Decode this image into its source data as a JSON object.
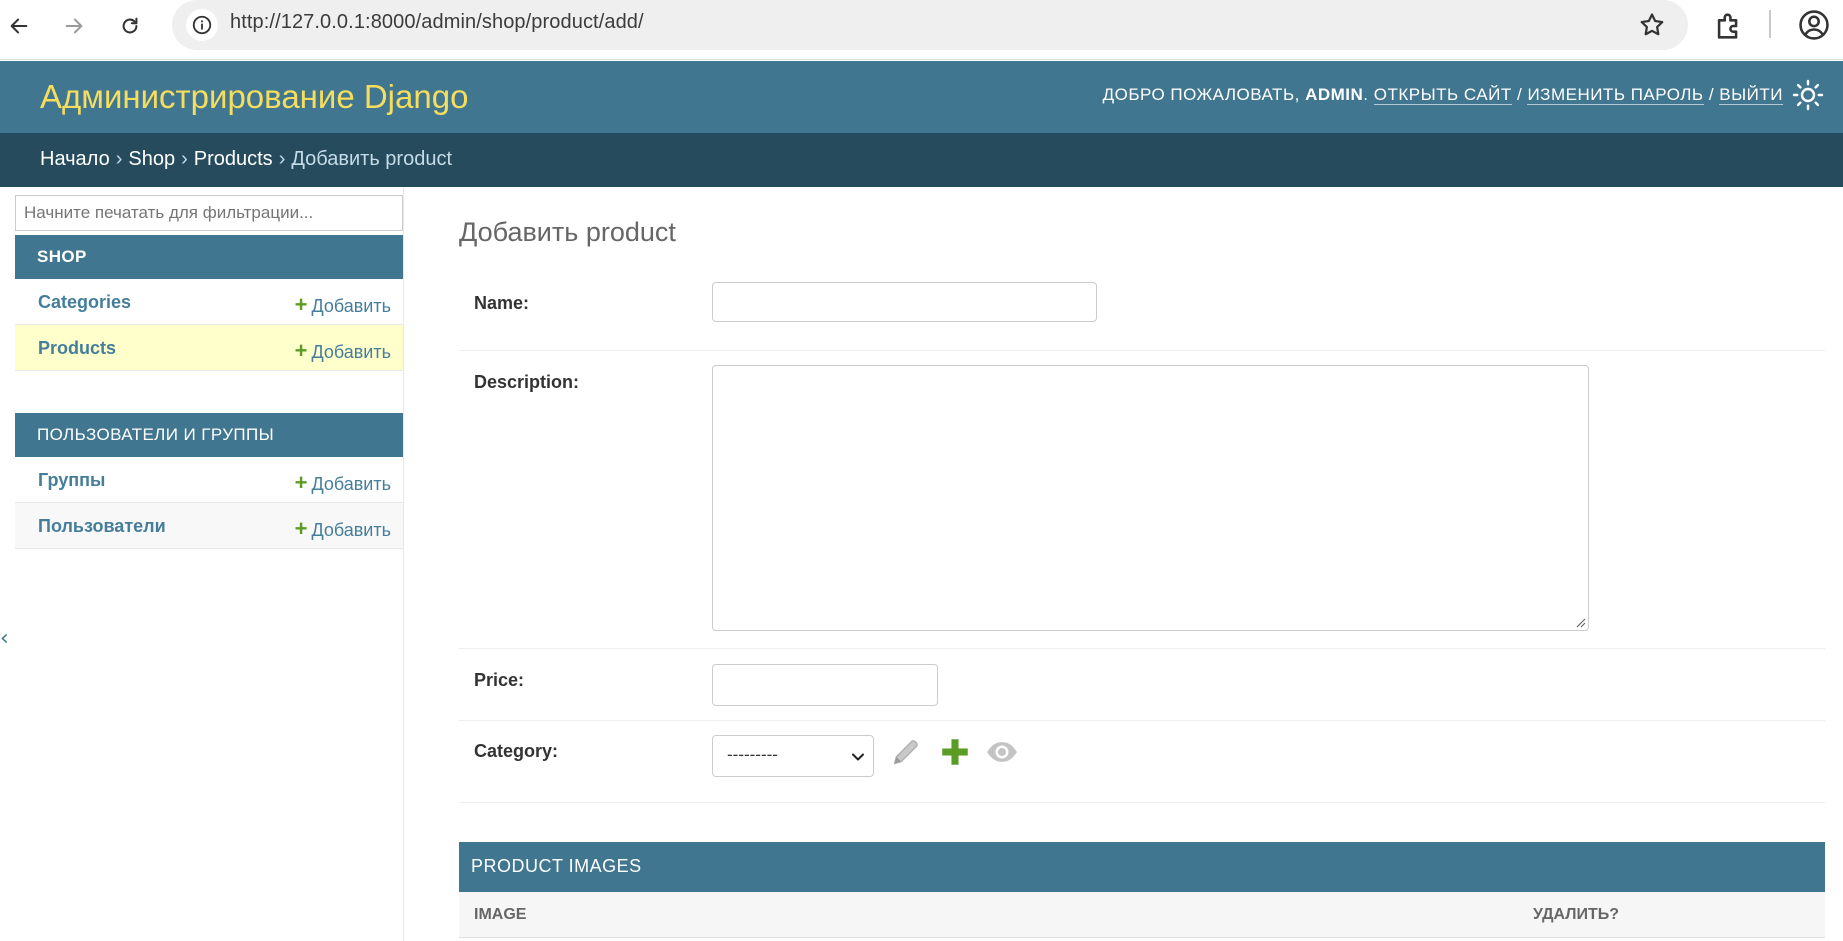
{
  "browser": {
    "url": "http://127.0.0.1:8000/admin/shop/product/add/"
  },
  "header": {
    "site_title": "Администрирование Django",
    "welcome": "Добро пожаловать,",
    "username": "admin",
    "view_site": "Открыть сайт",
    "change_password": "Изменить пароль",
    "logout": "Выйти",
    "sep": "/"
  },
  "breadcrumbs": {
    "home": "Начало",
    "app": "Shop",
    "model": "Products",
    "current": "Добавить product",
    "sep": "›"
  },
  "sidebar": {
    "filter_placeholder": "Начните печатать для фильтрации...",
    "apps": [
      {
        "caption": "Shop",
        "models": [
          {
            "name": "Categories",
            "add": "Добавить"
          },
          {
            "name": "Products",
            "add": "Добавить"
          }
        ]
      },
      {
        "caption": "Пользователи и группы",
        "models": [
          {
            "name": "Группы",
            "add": "Добавить"
          },
          {
            "name": "Пользователи",
            "add": "Добавить"
          }
        ]
      }
    ],
    "collapse_glyph": "‹"
  },
  "main": {
    "title": "Добавить product",
    "fields": {
      "name_label": "Name:",
      "description_label": "Description:",
      "price_label": "Price:",
      "category_label": "Category:",
      "category_selected": "---------"
    },
    "inline": {
      "title": "Product images",
      "col_image": "Image",
      "col_delete": "Удалить?"
    }
  },
  "colors": {
    "header_bg": "#417690",
    "breadcrumbs_bg": "#264b5d",
    "title_yellow": "#f5dd5d",
    "link": "#447e9b",
    "add_green": "#5b9c24",
    "current_row": "#ffffcc"
  }
}
